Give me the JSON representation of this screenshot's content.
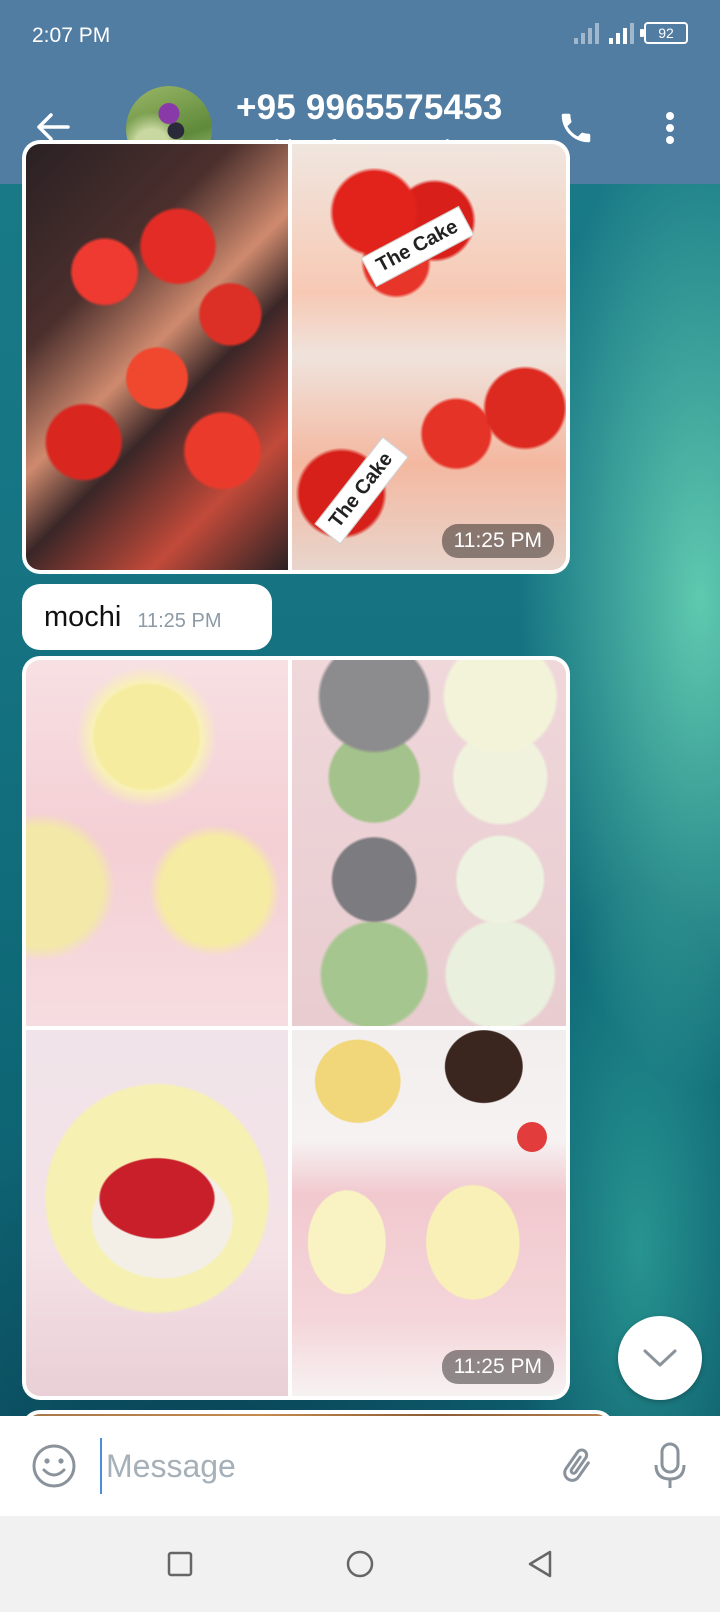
{
  "status_bar": {
    "time": "2:07 PM",
    "battery": "92",
    "icons": [
      "signal-icon",
      "signal-icon",
      "battery-icon"
    ]
  },
  "header": {
    "contact_name": "+95 9965575453",
    "contact_status": "Waiting for network...",
    "icons": {
      "back": "back-arrow-icon",
      "call": "phone-icon",
      "menu": "more-vertical-icon"
    },
    "color": "#527da3"
  },
  "messages": [
    {
      "type": "media_album",
      "photos": [
        "strawberry-cake-boxes",
        "strawberry-cake-slices"
      ],
      "labels": [
        "The Cake",
        "The Cake"
      ],
      "time": "11:25 PM"
    },
    {
      "type": "text",
      "text": "mochi",
      "time": "11:25 PM"
    },
    {
      "type": "media_album",
      "photos": [
        "mochi-in-cups",
        "mochi-box-assorted",
        "mochi-bitten",
        "cake-and-mochi-box"
      ],
      "time": "11:25 PM"
    }
  ],
  "composer": {
    "placeholder": "Message",
    "icons": {
      "emoji": "emoji-icon",
      "attach": "paperclip-icon",
      "mic": "microphone-icon"
    }
  },
  "scroll_down_icon": "chevron-down-icon",
  "navbar": {
    "icons": [
      "recent-apps-icon",
      "home-icon",
      "back-icon"
    ]
  }
}
